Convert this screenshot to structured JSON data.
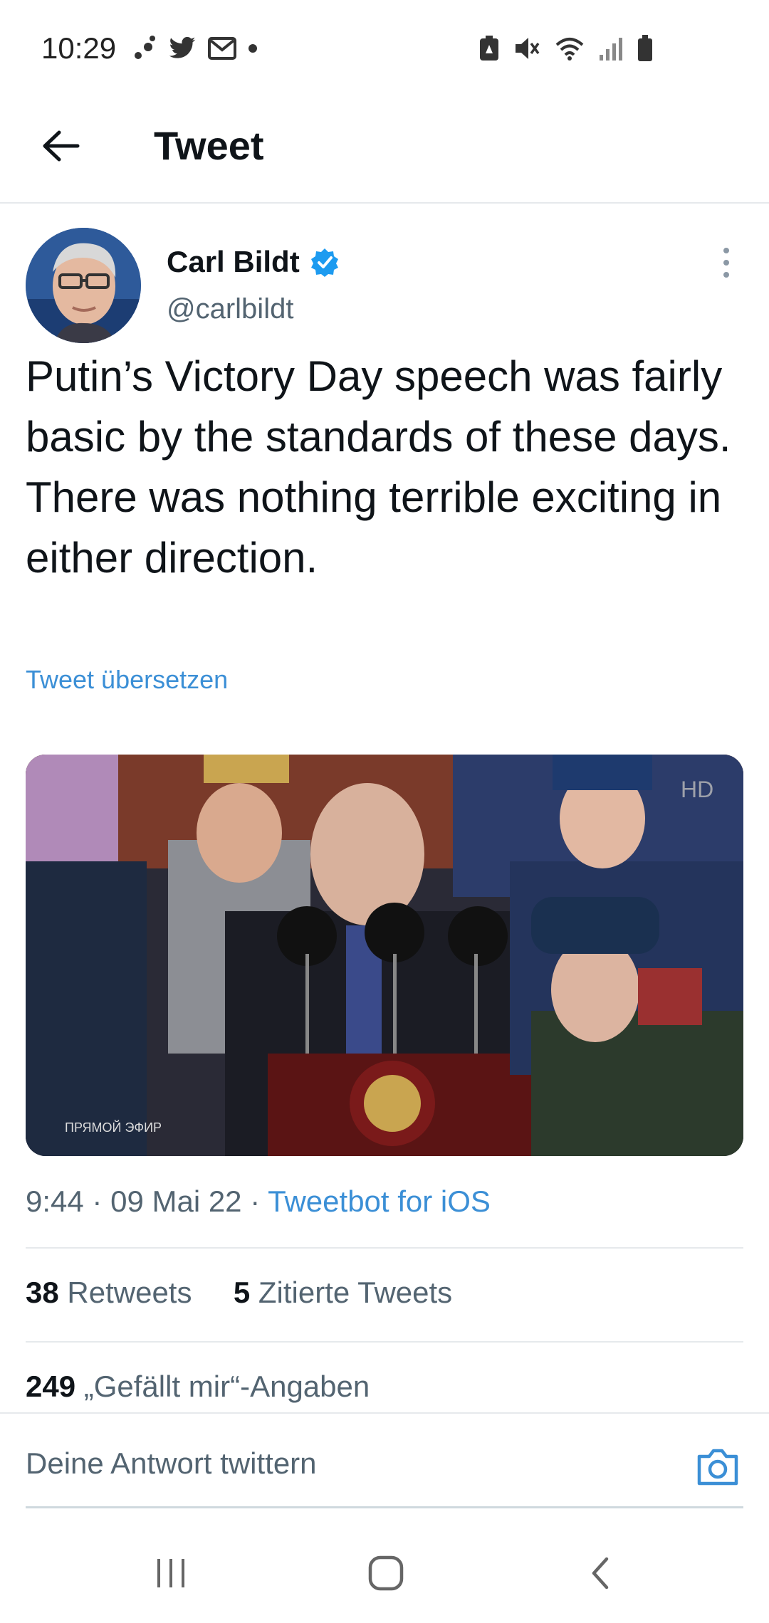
{
  "status_bar": {
    "time": "10:29",
    "left_icons": [
      "notification-dots-icon",
      "twitter-bird-icon",
      "mail-icon",
      "dot-icon"
    ],
    "right_icons": [
      "battery-saver-icon",
      "mute-icon",
      "wifi-icon",
      "signal-icon",
      "battery-icon"
    ]
  },
  "header": {
    "title": "Tweet",
    "back_icon": "arrow-left-icon"
  },
  "tweet": {
    "author_name": "Carl Bildt",
    "author_handle": "@carlbildt",
    "verified": true,
    "text": "Putin’s Victory Day speech was fairly basic by the standards of these days. There was nothing terrible exciting in either direction.",
    "translate_label": "Tweet übersetzen",
    "media": {
      "overlay_text_left": "ПРЯМОЙ ЭФИР",
      "overlay_text_right": "HD"
    },
    "time": "9:44",
    "date": "09 Mai 22",
    "separator": "·",
    "client": "Tweetbot for iOS"
  },
  "stats": {
    "retweets_count": "38",
    "retweets_label": "Retweets",
    "quotes_count": "5",
    "quotes_label": "Zitierte Tweets",
    "likes_count": "249",
    "likes_label": "„Gefällt mir“-Angaben"
  },
  "reply": {
    "placeholder": "Deine Antwort twittern",
    "camera_icon": "camera-icon"
  },
  "colors": {
    "accent": "#1d9bf0",
    "link": "#3b8fd6",
    "muted": "#536471",
    "divider": "#e6e9ec"
  },
  "nav_bar": {
    "icons": [
      "recents-icon",
      "home-icon",
      "back-icon"
    ]
  }
}
